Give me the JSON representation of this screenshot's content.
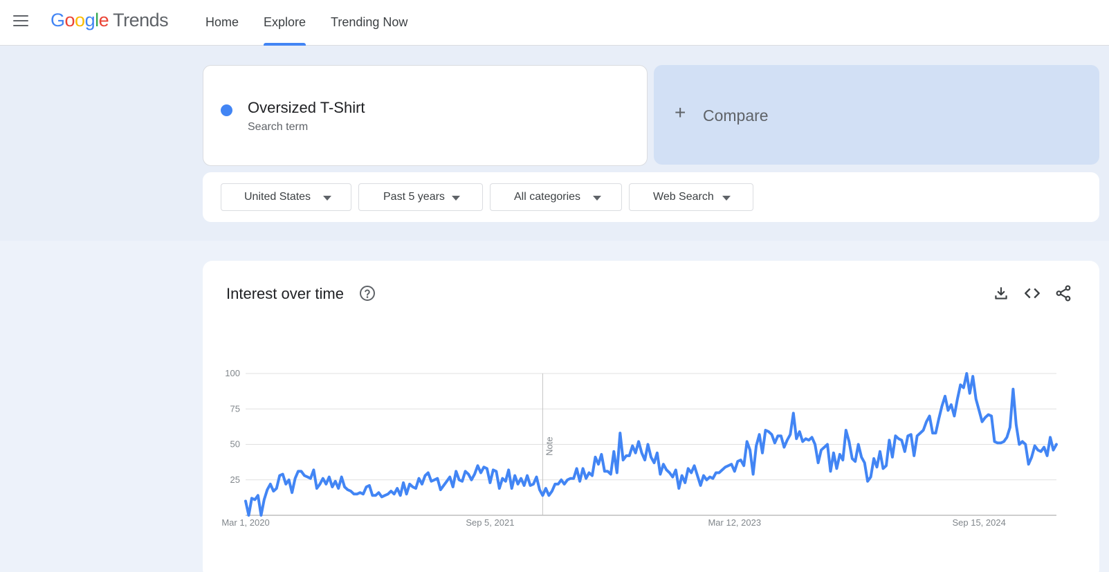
{
  "header": {
    "logo_letters": [
      "G",
      "o",
      "o",
      "g",
      "l",
      "e"
    ],
    "logo_product": "Trends",
    "nav": [
      {
        "label": "Home",
        "active": false
      },
      {
        "label": "Explore",
        "active": true
      },
      {
        "label": "Trending Now",
        "active": false
      }
    ]
  },
  "term": {
    "name": "Oversized T-Shirt",
    "type": "Search term",
    "color": "#4285f4"
  },
  "compare": {
    "plus": "+",
    "label": "Compare"
  },
  "filters": [
    {
      "label": "United States"
    },
    {
      "label": "Past 5 years"
    },
    {
      "label": "All categories"
    },
    {
      "label": "Web Search"
    }
  ],
  "chart_card": {
    "title": "Interest over time",
    "icons": [
      "help-icon",
      "download-icon",
      "embed-icon",
      "share-icon"
    ]
  },
  "chart_data": {
    "type": "line",
    "title": "Interest over time",
    "xlabel": "",
    "ylabel": "",
    "ylim": [
      0,
      100
    ],
    "y_ticks": [
      25,
      50,
      75,
      100
    ],
    "x_tick_labels": [
      "Mar 1, 2020",
      "Sep 5, 2021",
      "Mar 12, 2023",
      "Sep 15, 2024"
    ],
    "x_start": "2020-03-01",
    "x_interval": "weekly",
    "annotation": "Note",
    "annotation_date": "2022-01-02",
    "grid": true,
    "series": [
      {
        "name": "Oversized T-Shirt",
        "color": "#4285f4",
        "values": [
          10,
          0,
          12,
          11,
          14,
          0,
          11,
          18,
          22,
          17,
          19,
          28,
          29,
          22,
          25,
          16,
          26,
          31,
          31,
          28,
          27,
          26,
          32,
          19,
          22,
          26,
          22,
          27,
          20,
          24,
          19,
          27,
          20,
          18,
          17,
          15,
          15,
          16,
          15,
          20,
          21,
          14,
          14,
          16,
          13,
          14,
          15,
          17,
          15,
          19,
          14,
          23,
          15,
          22,
          20,
          19,
          26,
          22,
          28,
          30,
          24,
          25,
          26,
          18,
          21,
          24,
          27,
          20,
          31,
          25,
          24,
          31,
          29,
          25,
          29,
          35,
          30,
          34,
          33,
          23,
          32,
          31,
          19,
          26,
          24,
          32,
          19,
          28,
          22,
          26,
          21,
          28,
          21,
          22,
          27,
          18,
          14,
          19,
          14,
          17,
          22,
          22,
          25,
          22,
          25,
          26,
          26,
          33,
          24,
          33,
          26,
          30,
          28,
          41,
          36,
          43,
          31,
          31,
          29,
          45,
          30,
          58,
          39,
          42,
          42,
          49,
          44,
          52,
          44,
          39,
          50,
          41,
          37,
          44,
          29,
          36,
          32,
          30,
          27,
          32,
          19,
          28,
          23,
          33,
          30,
          35,
          28,
          21,
          28,
          25,
          27,
          26,
          30,
          30,
          32,
          34,
          35,
          36,
          31,
          38,
          39,
          35,
          52,
          46,
          29,
          49,
          57,
          44,
          60,
          59,
          57,
          51,
          56,
          56,
          48,
          53,
          57,
          72,
          54,
          59,
          52,
          54,
          53,
          55,
          50,
          37,
          46,
          48,
          50,
          31,
          44,
          33,
          43,
          39,
          60,
          52,
          40,
          38,
          50,
          41,
          37,
          24,
          27,
          40,
          34,
          45,
          33,
          35,
          53,
          41,
          56,
          54,
          53,
          45,
          56,
          57,
          42,
          56,
          58,
          60,
          66,
          70,
          58,
          58,
          68,
          77,
          84,
          74,
          78,
          70,
          82,
          92,
          90,
          100,
          86,
          98,
          82,
          74,
          66,
          69,
          71,
          70,
          52,
          51,
          51,
          52,
          55,
          62,
          89,
          64,
          50,
          52,
          50,
          36,
          41,
          49,
          46,
          45,
          48,
          42,
          55,
          46,
          50
        ]
      }
    ]
  }
}
